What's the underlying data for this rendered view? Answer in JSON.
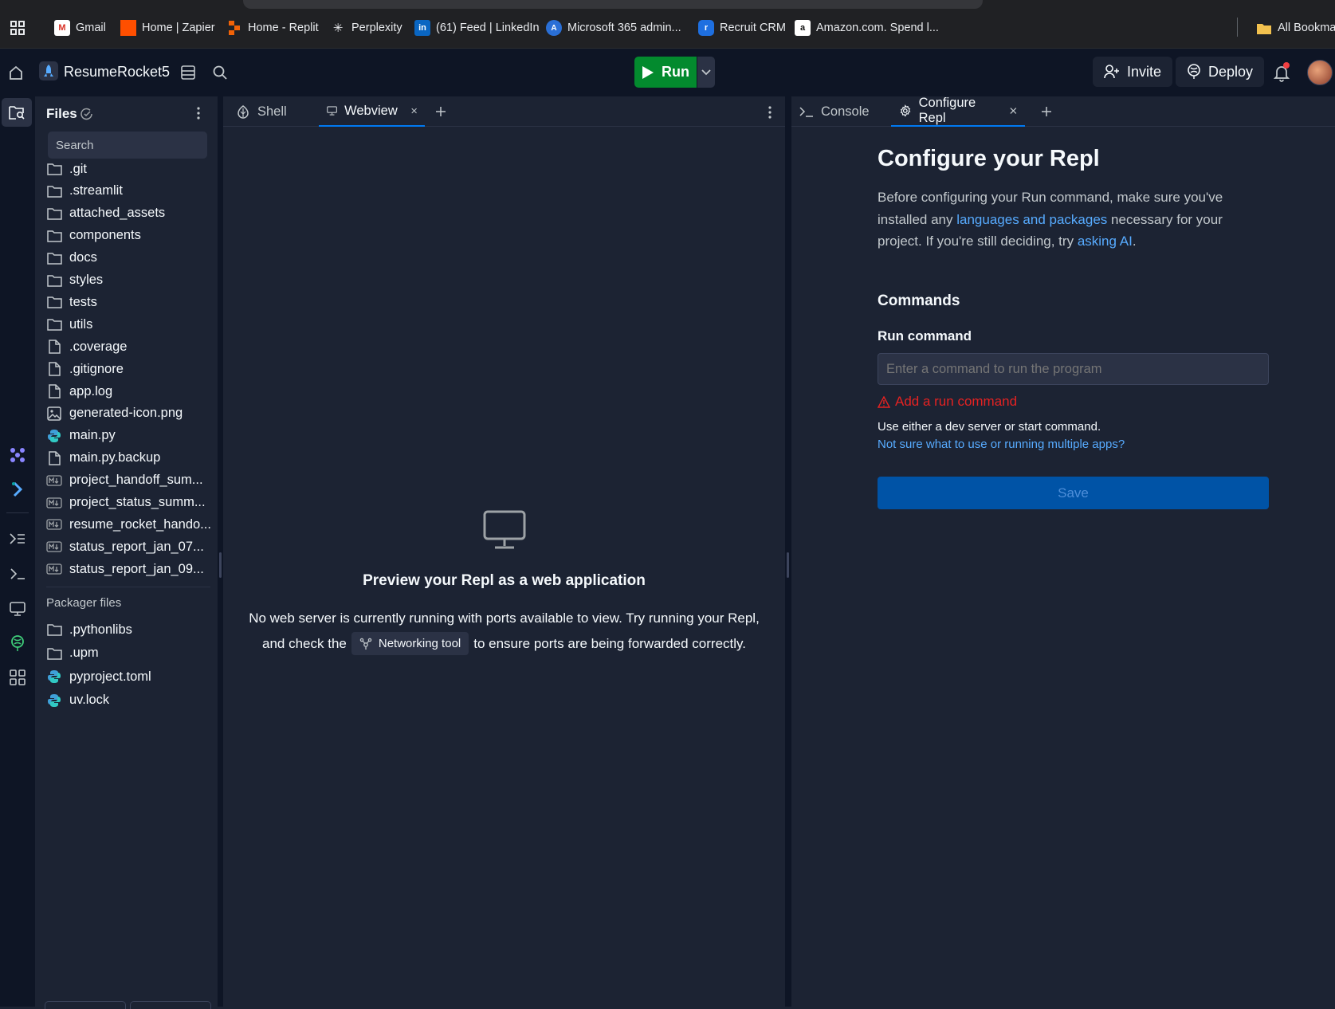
{
  "bookmarks": {
    "items": [
      {
        "label": "Gmail",
        "icon": "gmail-icon"
      },
      {
        "label": "Home | Zapier",
        "icon": "zapier-icon"
      },
      {
        "label": "Home - Replit",
        "icon": "replit-icon"
      },
      {
        "label": "Perplexity",
        "icon": "perplexity-icon"
      },
      {
        "label": "(61) Feed | LinkedIn",
        "icon": "linkedin-icon"
      },
      {
        "label": "Microsoft 365 admin...",
        "icon": "microsoft-icon"
      },
      {
        "label": "Recruit CRM",
        "icon": "recruit-crm-icon"
      },
      {
        "label": "Amazon.com. Spend l...",
        "icon": "amazon-icon"
      }
    ],
    "all_bookmarks": "All Bookmar"
  },
  "header": {
    "project_name": "ResumeRocket5",
    "run_label": "Run",
    "invite_label": "Invite",
    "deploy_label": "Deploy"
  },
  "files": {
    "title": "Files",
    "search_placeholder": "Search",
    "items": [
      {
        "name": ".git",
        "type": "folder"
      },
      {
        "name": ".streamlit",
        "type": "folder"
      },
      {
        "name": "attached_assets",
        "type": "folder"
      },
      {
        "name": "components",
        "type": "folder"
      },
      {
        "name": "docs",
        "type": "folder"
      },
      {
        "name": "styles",
        "type": "folder"
      },
      {
        "name": "tests",
        "type": "folder"
      },
      {
        "name": "utils",
        "type": "folder"
      },
      {
        "name": ".coverage",
        "type": "file"
      },
      {
        "name": ".gitignore",
        "type": "file"
      },
      {
        "name": "app.log",
        "type": "file"
      },
      {
        "name": "generated-icon.png",
        "type": "image"
      },
      {
        "name": "main.py",
        "type": "python"
      },
      {
        "name": "main.py.backup",
        "type": "file"
      },
      {
        "name": "project_handoff_sum...",
        "type": "markdown"
      },
      {
        "name": "project_status_summ...",
        "type": "markdown"
      },
      {
        "name": "resume_rocket_hando...",
        "type": "markdown"
      },
      {
        "name": "status_report_jan_07...",
        "type": "markdown"
      },
      {
        "name": "status_report_jan_09...",
        "type": "markdown"
      }
    ],
    "packager_title": "Packager files",
    "packager_items": [
      {
        "name": ".pythonlibs",
        "type": "folder"
      },
      {
        "name": ".upm",
        "type": "folder"
      },
      {
        "name": "pyproject.toml",
        "type": "python"
      },
      {
        "name": "uv.lock",
        "type": "python"
      }
    ]
  },
  "middle": {
    "tabs": [
      {
        "label": "Shell",
        "icon": "shell-icon"
      },
      {
        "label": "Webview",
        "icon": "monitor-icon"
      }
    ],
    "preview_title": "Preview your Repl as a web application",
    "preview_line1": "No web server is currently running with ports available to view. Try running your Repl,",
    "preview_line2_a": "and check the",
    "preview_chip": "Networking tool",
    "preview_line2_b": "to ensure ports are being forwarded correctly."
  },
  "right": {
    "tabs": [
      {
        "label": "Console",
        "icon": "console-icon"
      },
      {
        "label": "Configure Repl",
        "icon": "gear-icon"
      }
    ],
    "heading": "Configure your Repl",
    "intro_1": "Before configuring your Run command, make sure you've",
    "intro_2": "installed any",
    "intro_link1": "languages and packages",
    "intro_3": "necessary for your",
    "intro_4": "project. If you're still deciding, try",
    "intro_link2": "asking AI",
    "intro_5": ".",
    "commands_heading": "Commands",
    "run_command_label": "Run command",
    "run_command_placeholder": "Enter a command to run the program",
    "run_command_value": "",
    "error_text": "Add a run command",
    "help_text": "Use either a dev server or start command.",
    "help_link": "Not sure what to use or running multiple apps?",
    "save_label": "Save"
  }
}
